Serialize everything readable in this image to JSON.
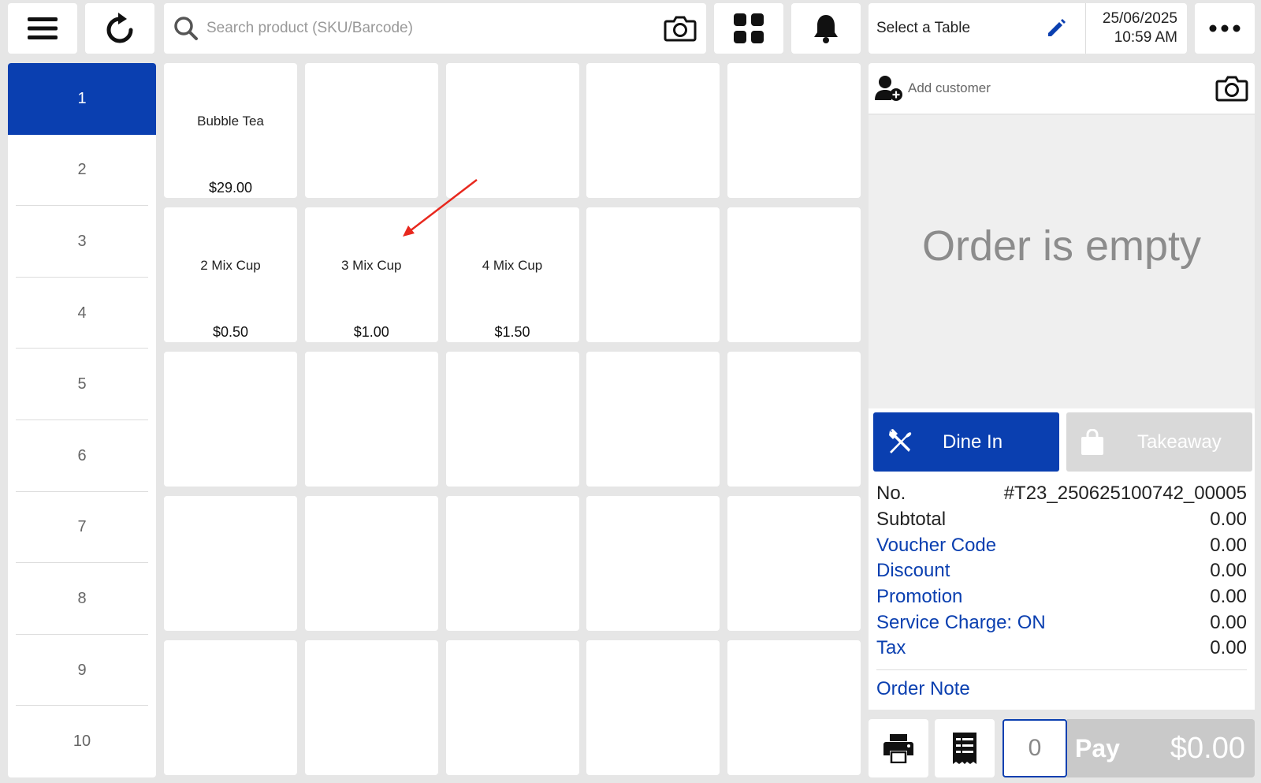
{
  "top_bar": {
    "search_placeholder": "Search product (SKU/Barcode)",
    "table_label": "Select a Table",
    "date": "25/06/2025",
    "time": "10:59 AM"
  },
  "categories": [
    "1",
    "2",
    "3",
    "4",
    "5",
    "6",
    "7",
    "8",
    "9",
    "10"
  ],
  "active_category": "1",
  "products": [
    {
      "name": "Bubble Tea",
      "price": "$29.00"
    },
    {
      "name": "",
      "price": ""
    },
    {
      "name": "",
      "price": ""
    },
    {
      "name": "",
      "price": ""
    },
    {
      "name": "",
      "price": ""
    },
    {
      "name": "2 Mix Cup",
      "price": "$0.50"
    },
    {
      "name": "3 Mix Cup",
      "price": "$1.00"
    },
    {
      "name": "4 Mix Cup",
      "price": "$1.50"
    }
  ],
  "customer": {
    "add_label": "Add customer"
  },
  "order": {
    "empty_text": "Order is empty",
    "dine_in_label": "Dine In",
    "takeaway_label": "Takeaway",
    "number_label": "No.",
    "number_value": "#T23_250625100742_00005",
    "rows": [
      {
        "label": "Subtotal",
        "value": "0.00",
        "link": false
      },
      {
        "label": "Voucher Code",
        "value": "0.00",
        "link": true
      },
      {
        "label": "Discount",
        "value": "0.00",
        "link": true
      },
      {
        "label": "Promotion",
        "value": "0.00",
        "link": true
      },
      {
        "label": "Service Charge: ON",
        "value": "0.00",
        "link": true
      },
      {
        "label": "Tax",
        "value": "0.00",
        "link": true
      }
    ],
    "note_label": "Order Note"
  },
  "footer": {
    "quantity": "0",
    "pay_label": "Pay",
    "pay_amount": "$0.00"
  },
  "colors": {
    "accent": "#0a3fb0",
    "annotation_arrow": "#e8281e"
  }
}
